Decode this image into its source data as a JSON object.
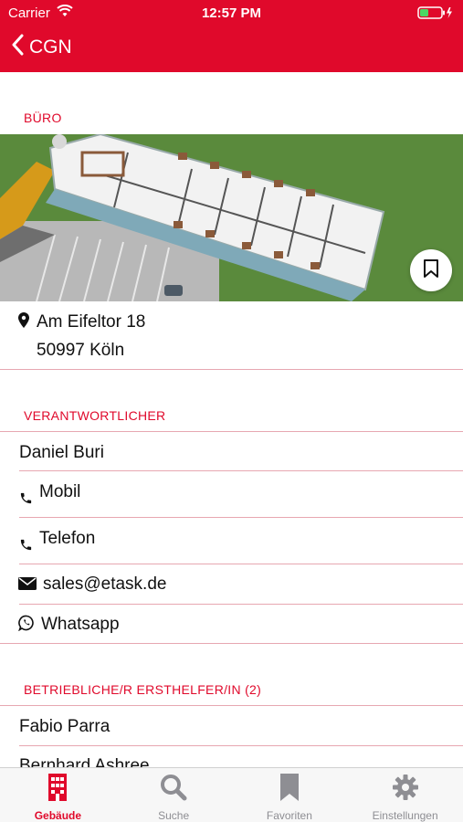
{
  "status": {
    "carrier": "Carrier",
    "time": "12:57 PM"
  },
  "nav": {
    "back_label": "CGN"
  },
  "office": {
    "section_title": "BÜRO",
    "street": "Am Eifeltor 18",
    "city": "50997 Köln"
  },
  "responsible": {
    "section_title": "VERANTWORTLICHER",
    "name": "Daniel Buri",
    "mobile_label": "Mobil",
    "phone_label": "Telefon",
    "email": "sales@etask.de",
    "whatsapp_label": "Whatsapp"
  },
  "first_aid": {
    "section_title": "BETRIEBLICHE/R ERSTHELFER/IN (2)",
    "people": [
      "Fabio Parra",
      "Bernhard Ashree"
    ]
  },
  "tabs": [
    {
      "label": "Gebäude",
      "icon": "building-icon",
      "active": true
    },
    {
      "label": "Suche",
      "icon": "search-icon",
      "active": false
    },
    {
      "label": "Favoriten",
      "icon": "bookmark-icon",
      "active": false
    },
    {
      "label": "Einstellungen",
      "icon": "gear-icon",
      "active": false
    }
  ],
  "colors": {
    "accent": "#e0092b",
    "divider": "#e7a7b1",
    "tab_inactive": "#8e8e93"
  }
}
